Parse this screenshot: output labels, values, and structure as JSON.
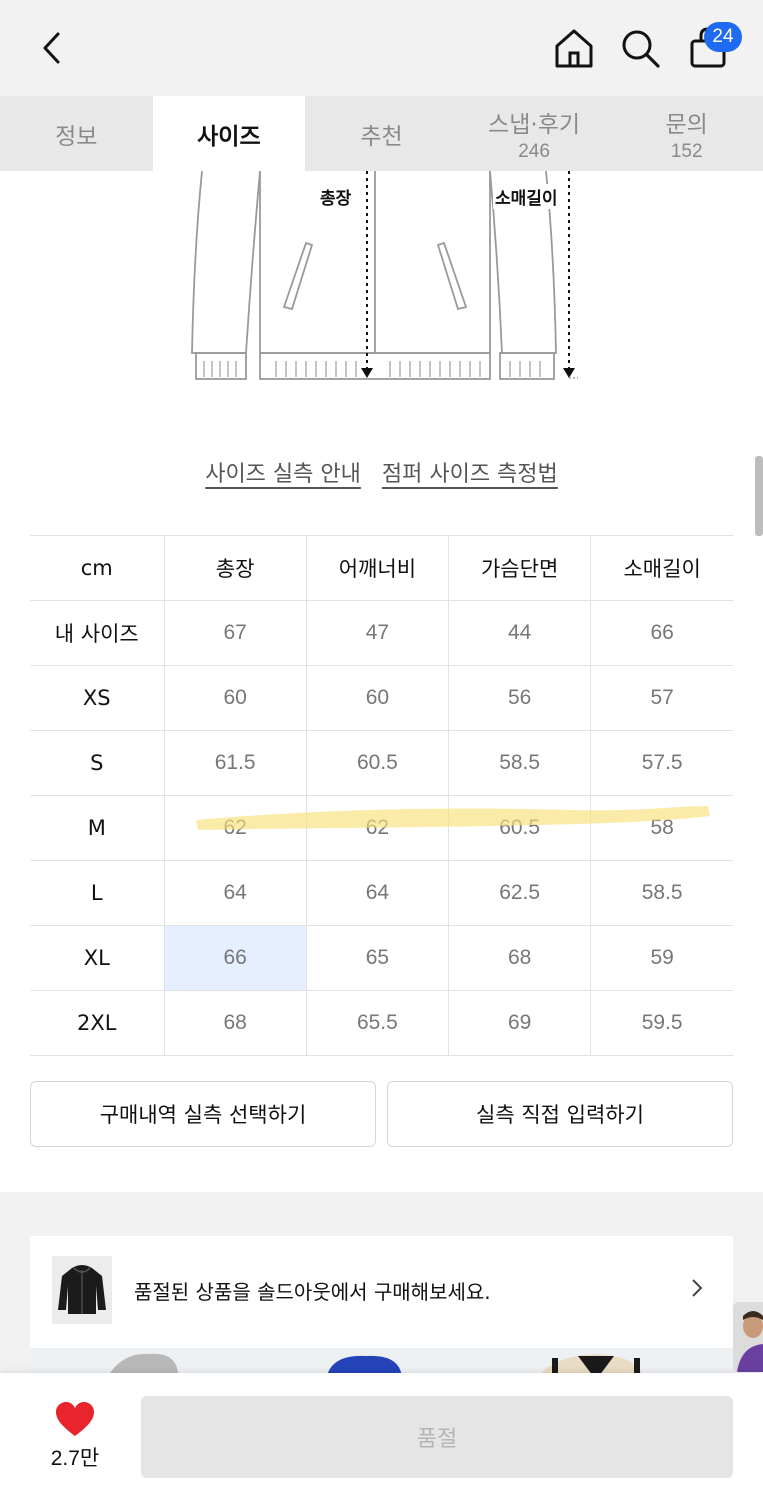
{
  "header": {
    "back_icon": "chevron-left-icon",
    "home_icon": "home-icon",
    "search_icon": "search-icon",
    "bag_icon": "shopping-bag-icon",
    "bag_count": "24",
    "badge_color": "#1e6af0"
  },
  "tabs": [
    {
      "label": "정보",
      "count": ""
    },
    {
      "label": "사이즈",
      "count": ""
    },
    {
      "label": "추천",
      "count": ""
    },
    {
      "label": "스냅·후기",
      "count": "246"
    },
    {
      "label": "문의",
      "count": "152"
    }
  ],
  "active_tab": "사이즈",
  "illustration": {
    "length_label": "총장",
    "sleeve_label": "소매길이"
  },
  "links": {
    "size_guide": "사이즈 실측 안내",
    "jumper_measure": "점퍼 사이즈 측정법"
  },
  "size_table": {
    "headers": [
      "cm",
      "총장",
      "어깨너비",
      "가슴단면",
      "소매길이"
    ],
    "rows": [
      [
        "내 사이즈",
        "67",
        "47",
        "44",
        "66"
      ],
      [
        "XS",
        "60",
        "60",
        "56",
        "57"
      ],
      [
        "S",
        "61.5",
        "60.5",
        "58.5",
        "57.5"
      ],
      [
        "M",
        "62",
        "62",
        "60.5",
        "58"
      ],
      [
        "L",
        "64",
        "64",
        "62.5",
        "58.5"
      ],
      [
        "XL",
        "66",
        "65",
        "68",
        "59"
      ],
      [
        "2XL",
        "68",
        "65.5",
        "69",
        "59.5"
      ]
    ],
    "highlighted_row": "M",
    "highlight_color": "#f7e07a",
    "selected_cell_color": "#e6efff"
  },
  "buttons": {
    "purchase_history": "구매내역 실측 선택하기",
    "manual_input": "실측 직접 입력하기"
  },
  "promo": {
    "text": "품절된 상품을 솔드아웃에서 구매해보세요.",
    "arrow_icon": "chevron-right-icon"
  },
  "bottom": {
    "heart_icon": "heart-icon",
    "heart_color": "#e8242c",
    "like_count": "2.7만",
    "soldout_label": "품절"
  }
}
